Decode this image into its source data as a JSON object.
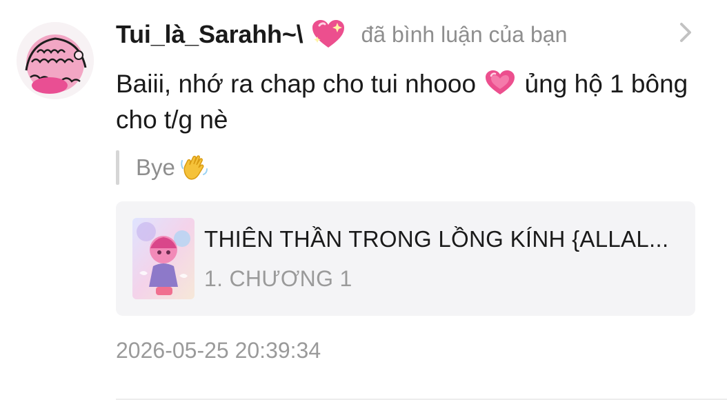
{
  "notification": {
    "username": "Tui_là_Sarahh~\\",
    "action_text": "đã bình luận của bạn",
    "comment_text_part1": "Baiii, nhớ ra chap cho tui nhooo",
    "comment_text_part2": "ủng hộ 1 bông cho t/g nè",
    "quoted_text": "Bye",
    "story": {
      "title": "THIÊN THẦN TRONG LỒNG KÍNH {ALLAL...",
      "chapter": "1. CHƯƠNG 1"
    },
    "timestamp": "2026-05-25 20:39:34"
  },
  "icons": {
    "username_badge": "sparkling-heart-icon",
    "comment_emoji": "growing-heart-icon",
    "quote_emoji": "waving-hand-icon",
    "chevron": "chevron-right-icon"
  },
  "colors": {
    "text_primary": "#1a1a1a",
    "text_secondary": "#8e8e8e",
    "card_background": "#f4f4f6",
    "heart_pink": "#ec4f8e"
  }
}
